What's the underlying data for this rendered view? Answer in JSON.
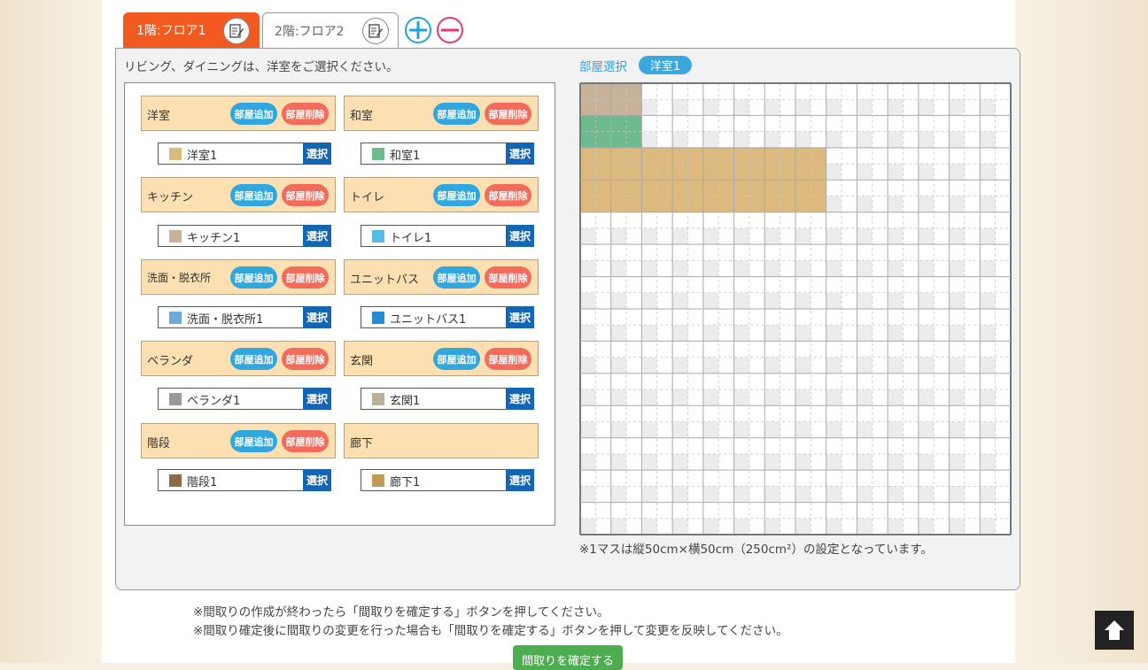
{
  "tabs": [
    {
      "label": "1階:フロア1",
      "active": true
    },
    {
      "label": "2階:フロア2",
      "active": false
    }
  ],
  "instruction": "リビング、ダイニングは、洋室をご選択ください。",
  "buttons": {
    "add_room": "部屋追加",
    "delete_room": "部屋削除",
    "select": "選択"
  },
  "categories": [
    {
      "label": "洋室",
      "room": "洋室1",
      "color": "#dcb97e",
      "has_buttons": true
    },
    {
      "label": "和室",
      "room": "和室1",
      "color": "#6dba8e",
      "has_buttons": true
    },
    {
      "label": "キッチン",
      "room": "キッチン1",
      "color": "#c8b39a",
      "has_buttons": true
    },
    {
      "label": "トイレ",
      "room": "トイレ1",
      "color": "#56bde9",
      "has_buttons": true
    },
    {
      "label": "洗面・脱衣所",
      "room": "洗面・脱衣所1",
      "color": "#6fa9dc",
      "has_buttons": true
    },
    {
      "label": "ユニットバス",
      "room": "ユニットバス1",
      "color": "#268bd0",
      "has_buttons": true
    },
    {
      "label": "ベランダ",
      "room": "ベランダ1",
      "color": "#999999",
      "has_buttons": true
    },
    {
      "label": "玄関",
      "room": "玄関1",
      "color": "#b8b298",
      "has_buttons": true
    },
    {
      "label": "階段",
      "room": "階段1",
      "color": "#8b6c45",
      "has_buttons": true
    },
    {
      "label": "廊下",
      "room": "廊下1",
      "color": "#c49a56",
      "has_buttons": false
    }
  ],
  "room_selection": {
    "label": "部屋選択",
    "selected": "洋室1"
  },
  "grid_note": "※1マスは縦50cm×横50cm（250cm²）の設定となっています。",
  "bottom_notes": [
    "※間取りの作成が終わったら「間取りを確定する」ボタンを押してください。",
    "※間取り確定後に間取りの変更を行った場合も「間取りを確定する」ボタンを押して変更を反映してください。"
  ],
  "confirm_button": "間取りを確定する",
  "colors": {
    "accent_tab": "#f25a1f",
    "select_button": "#1565b5",
    "add_pill": "#31a7df",
    "delete_pill": "#f26b5b",
    "category_bg": "#fde0b2"
  }
}
